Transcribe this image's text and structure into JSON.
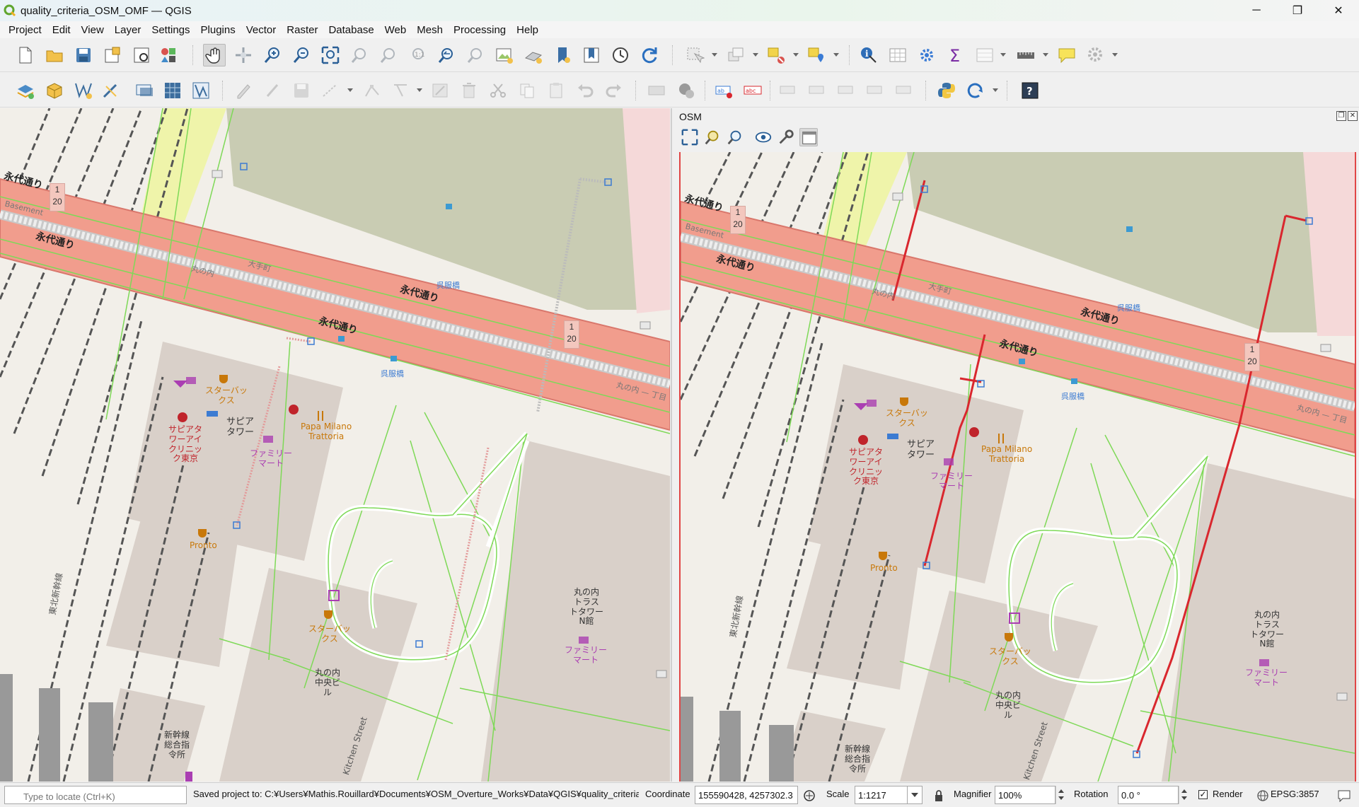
{
  "window": {
    "title": "quality_criteria_OSM_OMF — QGIS",
    "minimize": "─",
    "maximize": "❐",
    "close": "✕"
  },
  "menu": [
    "Project",
    "Edit",
    "View",
    "Layer",
    "Settings",
    "Plugins",
    "Vector",
    "Raster",
    "Database",
    "Web",
    "Mesh",
    "Processing",
    "Help"
  ],
  "osm_panel": {
    "title": "OSM",
    "float_btn": "❐",
    "close_btn": "✕"
  },
  "map_labels": {
    "road_eidai_1": "永代通り",
    "road_eidai_2": "永代通り",
    "road_eidai_3": "永代通り",
    "otemachi": "大手町",
    "marunouchi": "丸の内",
    "marunouchi_sub": "丸の内 — 丁目",
    "basement": "Basement",
    "shield_num_a": "1",
    "shield_num_b": "20",
    "gofukubashi_1": "呉服橋",
    "gofukubashi_2": "呉服橋",
    "starbucks_1": "スターバッ\nクス",
    "starbucks_2": "スターバッ\nクス",
    "sapia_tower": "サピア\nタワー",
    "sapia_clinic": "サピアタ\nワーアイ\nクリニッ\nク東京",
    "familymart_1": "ファミリー\nマート",
    "familymart_2": "ファミリー\nマート",
    "papa_milano": "Papa Milano\nTrattoria",
    "pronto": "Pronto",
    "trust_tower": "丸の内\nトラス\nトタワー\nN館",
    "chuo_bldg": "丸の内\n中央ビ\nル",
    "shinkansen_ctrl": "新幹線\n総合指\n令所",
    "tohoku_shinkansen": "東北新幹線",
    "kitchen_street": "Kitchen Street"
  },
  "status": {
    "locate_placeholder": "Type to locate (Ctrl+K)",
    "message": "Saved project to: C:¥Users¥Mathis.Rouillard¥Documents¥OSM_Overture_Works¥Data¥QGIS¥quality_criteria_O",
    "coordinate_label": "Coordinate",
    "coordinate_value": "155590428, 4257302.3",
    "scale_label": "Scale",
    "scale_value": "1:1217",
    "magnifier_label": "Magnifier",
    "magnifier_value": "100%",
    "rotation_label": "Rotation",
    "rotation_value": "0.0 °",
    "render_label": "Render",
    "render_checked": "✓",
    "crs": "EPSG:3857"
  },
  "icons": {
    "toolbar1": [
      "new-project-icon",
      "open-project-icon",
      "save-project-icon",
      "print-layout-icon",
      "layout-manager-icon",
      "style-manager-icon",
      "pan-icon",
      "pan-to-selection-icon",
      "zoom-in-icon",
      "zoom-out-icon",
      "zoom-full-icon",
      "zoom-to-selection-icon",
      "zoom-to-layer-icon",
      "zoom-native-icon",
      "zoom-last-icon",
      "zoom-next-icon",
      "new-map-view-icon",
      "new-3d-view-icon",
      "new-bookmark-icon",
      "show-bookmarks-icon",
      "temporal-controller-icon",
      "refresh-icon",
      "select-features-icon",
      "select-by-value-icon",
      "deselect-icon",
      "select-by-location-icon",
      "identify-icon",
      "attribute-table-icon",
      "toolbox-icon",
      "statistics-icon",
      "open-field-calculator-icon",
      "measure-icon",
      "map-tips-icon",
      "settings-icon"
    ],
    "toolbar2": [
      "data-source-manager-icon",
      "new-geopackage-icon",
      "new-shapefile-icon",
      "new-temp-layer-icon",
      "new-virtual-layer-icon",
      "add-raster-icon",
      "add-mesh-icon",
      "toggle-editing-icon",
      "current-edits-icon",
      "save-edits-icon",
      "digitize-icon",
      "vertex-tool-icon",
      "advanced-digitizing-icon",
      "modify-attributes-icon",
      "delete-selected-icon",
      "cut-features-icon",
      "copy-features-icon",
      "paste-features-icon",
      "undo-icon",
      "redo-icon",
      "label-toolbar-icon",
      "diagram-icon",
      "highlight-pinned-label-icon",
      "toggle-label-icon",
      "pin-label-icon",
      "show-hide-label-icon",
      "move-label-icon",
      "rotate-label-icon",
      "change-label-icon",
      "python-console-icon",
      "plugin-reloader-icon",
      "help-icon"
    ]
  },
  "colors": {
    "road_fill": "#f19d8d",
    "road_outline": "#d9776c",
    "footway_green": "#7ed957",
    "highlight_red": "#d9272e",
    "building": "#d9d0c9",
    "land": "#f2efe9",
    "park": "#c8c8b4"
  }
}
